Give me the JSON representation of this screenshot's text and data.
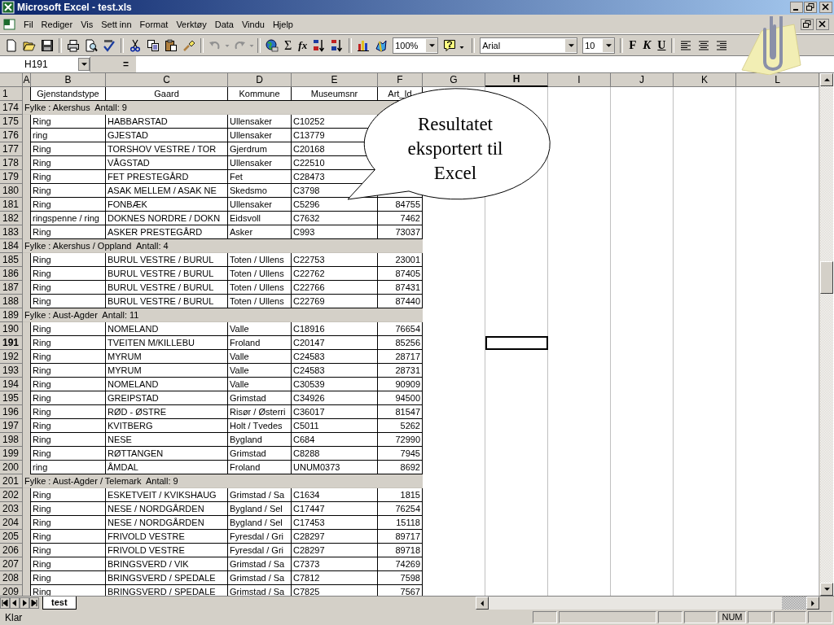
{
  "window": {
    "title": "Microsoft Excel - test.xls"
  },
  "menu": [
    {
      "label": "Fil"
    },
    {
      "label": "Rediger"
    },
    {
      "label": "Vis"
    },
    {
      "label": "Sett inn"
    },
    {
      "label": "Format"
    },
    {
      "label": "Verktøy"
    },
    {
      "label": "Data"
    },
    {
      "label": "Vindu"
    },
    {
      "label": "Hjelp"
    }
  ],
  "toolbar": {
    "sum": "Σ",
    "function": "fx",
    "zoom": "100%",
    "font": "Arial",
    "font_size": "10",
    "bold": "F",
    "italic": "K",
    "underline": "U"
  },
  "formula_bar": {
    "name_box": "H191",
    "equals": "="
  },
  "columns": [
    {
      "label": "A",
      "selected": false
    },
    {
      "label": "B",
      "selected": false
    },
    {
      "label": "C",
      "selected": false
    },
    {
      "label": "D",
      "selected": false
    },
    {
      "label": "E",
      "selected": false
    },
    {
      "label": "F",
      "selected": false
    },
    {
      "label": "G",
      "selected": false
    },
    {
      "label": "H",
      "selected": true
    },
    {
      "label": "I",
      "selected": false
    },
    {
      "label": "J",
      "selected": false
    },
    {
      "label": "K",
      "selected": false
    },
    {
      "label": "L",
      "selected": false
    }
  ],
  "rows": [
    {
      "number": "1",
      "kind": "header",
      "selected": false,
      "cells": [
        "Gjenstandstype",
        "Gaard",
        "Kommune",
        "Museumsnr",
        "Art_Id"
      ]
    },
    {
      "number": "174",
      "kind": "group",
      "selected": false,
      "text": "Fylke : Akershus  Antall: 9"
    },
    {
      "number": "175",
      "kind": "data",
      "selected": false,
      "cells": [
        "Ring",
        "HABBARSTAD",
        "Ullensaker",
        "C10252"
      ]
    },
    {
      "number": "176",
      "kind": "data",
      "selected": false,
      "cells": [
        "ring",
        "GJESTAD",
        "Ullensaker",
        "C13779"
      ]
    },
    {
      "number": "177",
      "kind": "data",
      "selected": false,
      "cells": [
        "Ring",
        "TORSHOV VESTRE / TOR",
        "Gjerdrum",
        "C20168"
      ]
    },
    {
      "number": "178",
      "kind": "data",
      "selected": false,
      "cells": [
        "Ring",
        "VÅGSTAD",
        "Ullensaker",
        "C22510"
      ]
    },
    {
      "number": "179",
      "kind": "data",
      "selected": false,
      "cells": [
        "Ring",
        "FET PRESTEGÅRD",
        "Fet",
        "C28473"
      ]
    },
    {
      "number": "180",
      "kind": "data",
      "selected": false,
      "cells": [
        "Ring",
        "ASAK MELLEM / ASAK NE",
        "Skedsmo",
        "C3798"
      ]
    },
    {
      "number": "181",
      "kind": "data",
      "selected": false,
      "cells": [
        "Ring",
        "FONBÆK",
        "Ullensaker",
        "C5296",
        "84755"
      ]
    },
    {
      "number": "182",
      "kind": "data",
      "selected": false,
      "cells": [
        "ringspenne / ring",
        "DOKNES NORDRE / DOKN",
        "Eidsvoll",
        "C7632",
        "7462"
      ]
    },
    {
      "number": "183",
      "kind": "data",
      "selected": false,
      "cells": [
        "Ring",
        "ASKER PRESTEGÅRD",
        "Asker",
        "C993",
        "73037"
      ]
    },
    {
      "number": "184",
      "kind": "group",
      "selected": false,
      "text": "Fylke : Akershus / Oppland  Antall: 4"
    },
    {
      "number": "185",
      "kind": "data",
      "selected": false,
      "cells": [
        "Ring",
        "BURUL VESTRE / BURUL",
        "Toten / Ullens",
        "C22753",
        "23001"
      ]
    },
    {
      "number": "186",
      "kind": "data",
      "selected": false,
      "cells": [
        "Ring",
        "BURUL VESTRE / BURUL",
        "Toten / Ullens",
        "C22762",
        "87405"
      ]
    },
    {
      "number": "187",
      "kind": "data",
      "selected": false,
      "cells": [
        "Ring",
        "BURUL VESTRE / BURUL",
        "Toten / Ullens",
        "C22766",
        "87431"
      ]
    },
    {
      "number": "188",
      "kind": "data",
      "selected": false,
      "cells": [
        "Ring",
        "BURUL VESTRE / BURUL",
        "Toten / Ullens",
        "C22769",
        "87440"
      ]
    },
    {
      "number": "189",
      "kind": "group",
      "selected": false,
      "text": "Fylke : Aust-Agder  Antall: 11"
    },
    {
      "number": "190",
      "kind": "data",
      "selected": false,
      "cells": [
        "Ring",
        "NOMELAND",
        "Valle",
        "C18916",
        "76654"
      ]
    },
    {
      "number": "191",
      "kind": "data",
      "selected": true,
      "cells": [
        "Ring",
        "TVEITEN M/KILLEBU",
        "Froland",
        "C20147",
        "85256"
      ]
    },
    {
      "number": "192",
      "kind": "data",
      "selected": false,
      "cells": [
        "Ring",
        "MYRUM",
        "Valle",
        "C24583",
        "28717"
      ]
    },
    {
      "number": "193",
      "kind": "data",
      "selected": false,
      "cells": [
        "Ring",
        "MYRUM",
        "Valle",
        "C24583",
        "28731"
      ]
    },
    {
      "number": "194",
      "kind": "data",
      "selected": false,
      "cells": [
        "Ring",
        "NOMELAND",
        "Valle",
        "C30539",
        "90909"
      ]
    },
    {
      "number": "195",
      "kind": "data",
      "selected": false,
      "cells": [
        "Ring",
        "GREIPSTAD",
        "Grimstad",
        "C34926",
        "94500"
      ]
    },
    {
      "number": "196",
      "kind": "data",
      "selected": false,
      "cells": [
        "Ring",
        "RØD - ØSTRE",
        "Risør / Østerri",
        "C36017",
        "81547"
      ]
    },
    {
      "number": "197",
      "kind": "data",
      "selected": false,
      "cells": [
        "Ring",
        "KVITBERG",
        "Holt / Tvedes",
        "C5011",
        "5262"
      ]
    },
    {
      "number": "198",
      "kind": "data",
      "selected": false,
      "cells": [
        "Ring",
        "NESE",
        "Bygland",
        "C684",
        "72990"
      ]
    },
    {
      "number": "199",
      "kind": "data",
      "selected": false,
      "cells": [
        "Ring",
        "RØTTANGEN",
        "Grimstad",
        "C8288",
        "7945"
      ]
    },
    {
      "number": "200",
      "kind": "data",
      "selected": false,
      "cells": [
        "ring",
        "ÅMDAL",
        "Froland",
        "UNUM0373",
        "8692"
      ]
    },
    {
      "number": "201",
      "kind": "group",
      "selected": false,
      "text": "Fylke : Aust-Agder / Telemark  Antall: 9"
    },
    {
      "number": "202",
      "kind": "data",
      "selected": false,
      "cells": [
        "Ring",
        "ESKETVEIT / KVIKSHAUG",
        "Grimstad / Sa",
        "C1634",
        "1815"
      ]
    },
    {
      "number": "203",
      "kind": "data",
      "selected": false,
      "cells": [
        "Ring",
        "NESE / NORDGÅRDEN",
        "Bygland / Sel",
        "C17447",
        "76254"
      ]
    },
    {
      "number": "204",
      "kind": "data",
      "selected": false,
      "cells": [
        "Ring",
        "NESE / NORDGÅRDEN",
        "Bygland / Sel",
        "C17453",
        "15118"
      ]
    },
    {
      "number": "205",
      "kind": "data",
      "selected": false,
      "cells": [
        "Ring",
        "FRIVOLD VESTRE",
        "Fyresdal / Gri",
        "C28297",
        "89717"
      ]
    },
    {
      "number": "206",
      "kind": "data",
      "selected": false,
      "cells": [
        "Ring",
        "FRIVOLD VESTRE",
        "Fyresdal / Gri",
        "C28297",
        "89718"
      ]
    },
    {
      "number": "207",
      "kind": "data",
      "selected": false,
      "cells": [
        "Ring",
        "BRINGSVERD / VIK",
        "Grimstad / Sa",
        "C7373",
        "74269"
      ]
    },
    {
      "number": "208",
      "kind": "data",
      "selected": false,
      "cells": [
        "Ring",
        "BRINGSVERD / SPEDALE",
        "Grimstad / Sa",
        "C7812",
        "7598"
      ]
    },
    {
      "number": "209",
      "kind": "data",
      "selected": false,
      "cells": [
        "Ring",
        "BRINGSVERD / SPEDALE",
        "Grimstad / Sa",
        "C7825",
        "7567"
      ]
    }
  ],
  "callout": {
    "text": "Resultatet eksportert til Excel"
  },
  "sheet_tabs": [
    {
      "label": "test",
      "selected": true
    }
  ],
  "status_bar": {
    "text": "Klar",
    "indicators": [
      "NUM"
    ]
  }
}
